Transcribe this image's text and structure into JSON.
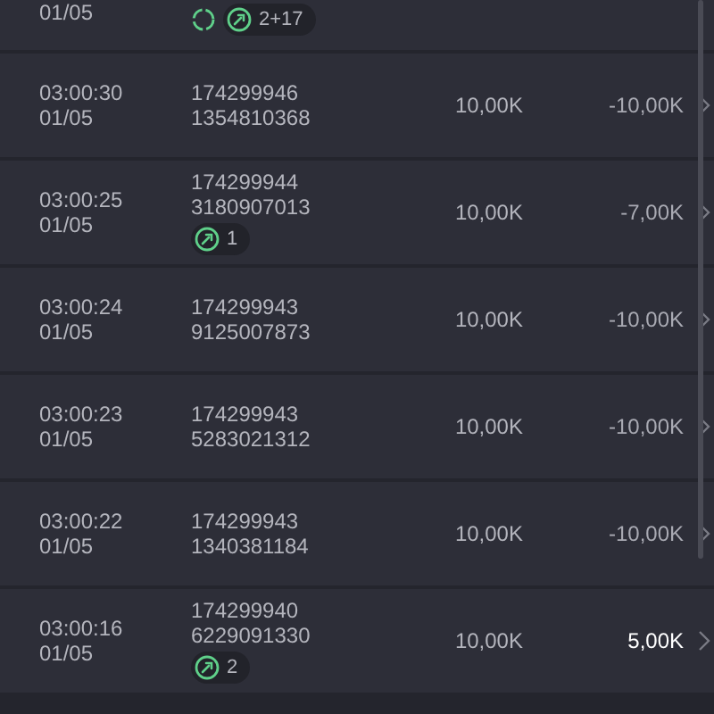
{
  "rows": [
    {
      "date": "01/05",
      "badges": [
        {
          "kind": "refresh"
        },
        {
          "kind": "count",
          "label": "2+17"
        }
      ]
    },
    {
      "time": "03:00:30",
      "date": "01/05",
      "ids": [
        "174299946",
        "1354810368"
      ],
      "amount": "10,00K",
      "value": "-10,00K",
      "highlighted": false,
      "badges": []
    },
    {
      "time": "03:00:25",
      "date": "01/05",
      "ids": [
        "174299944",
        "3180907013"
      ],
      "amount": "10,00K",
      "value": "-7,00K",
      "highlighted": false,
      "badges": [
        {
          "kind": "count",
          "label": "1"
        }
      ]
    },
    {
      "time": "03:00:24",
      "date": "01/05",
      "ids": [
        "174299943",
        "9125007873"
      ],
      "amount": "10,00K",
      "value": "-10,00K",
      "highlighted": false,
      "badges": []
    },
    {
      "time": "03:00:23",
      "date": "01/05",
      "ids": [
        "174299943",
        "5283021312"
      ],
      "amount": "10,00K",
      "value": "-10,00K",
      "highlighted": false,
      "badges": []
    },
    {
      "time": "03:00:22",
      "date": "01/05",
      "ids": [
        "174299943",
        "1340381184"
      ],
      "amount": "10,00K",
      "value": "-10,00K",
      "highlighted": false,
      "badges": []
    },
    {
      "time": "03:00:16",
      "date": "01/05",
      "ids": [
        "174299940",
        "6229091330"
      ],
      "amount": "10,00K",
      "value": "5,00K",
      "highlighted": true,
      "badges": [
        {
          "kind": "count",
          "label": "2"
        }
      ]
    }
  ]
}
